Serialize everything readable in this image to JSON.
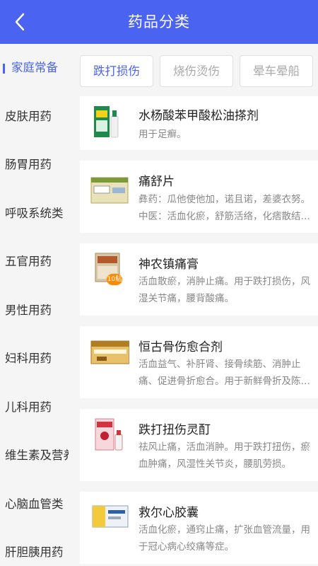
{
  "header": {
    "title": "药品分类",
    "back_icon": "chevron-left-icon"
  },
  "sidebar": {
    "items": [
      {
        "label": "家庭常备",
        "active": true
      },
      {
        "label": "皮肤用药"
      },
      {
        "label": "肠胃用药"
      },
      {
        "label": "呼吸系统类"
      },
      {
        "label": "五官用药"
      },
      {
        "label": "男性用药"
      },
      {
        "label": "妇科用药"
      },
      {
        "label": "儿科用药"
      },
      {
        "label": "维生素及营养"
      },
      {
        "label": "心脑血管类"
      },
      {
        "label": "肝胆胰用药"
      }
    ]
  },
  "tabs": [
    {
      "label": "跌打损伤",
      "active": true
    },
    {
      "label": "烧伤烫伤"
    },
    {
      "label": "晕车晕船"
    }
  ],
  "products": [
    {
      "name": "水杨酸苯甲酸松油搽剂",
      "desc": "用于足癣。"
    },
    {
      "name": "痛舒片",
      "desc": "彝药：瓜他使他加，诺且诺，差婆衣努。      中医：活血化瘀，舒筋活络，化痞散结，消肿止痛。"
    },
    {
      "name": "神农镇痛膏",
      "desc": "活血散瘀，消肿止痛。用于跌打损伤，风湿关节痛，腰背酸痛。",
      "badge": "10贴"
    },
    {
      "name": "恒古骨伤愈合剂",
      "desc": "活血益气、补肝肾、接骨续筋、消肿止痛、促进骨折愈合。用于新鲜骨折及陈旧骨折。"
    },
    {
      "name": "跌打扭伤灵酊",
      "desc": "祛风止痛，活血消肿。用于跌打扭伤，瘀血肿痛，风湿性关节炎，腰肌劳损。"
    },
    {
      "name": "救尔心胶囊",
      "desc": "活血化瘀，通窍止痛，扩张血管流量，用于冠心病心绞痛等症。"
    }
  ],
  "colors": {
    "accent": "#4a63f0",
    "badge": "#ff8a00"
  }
}
